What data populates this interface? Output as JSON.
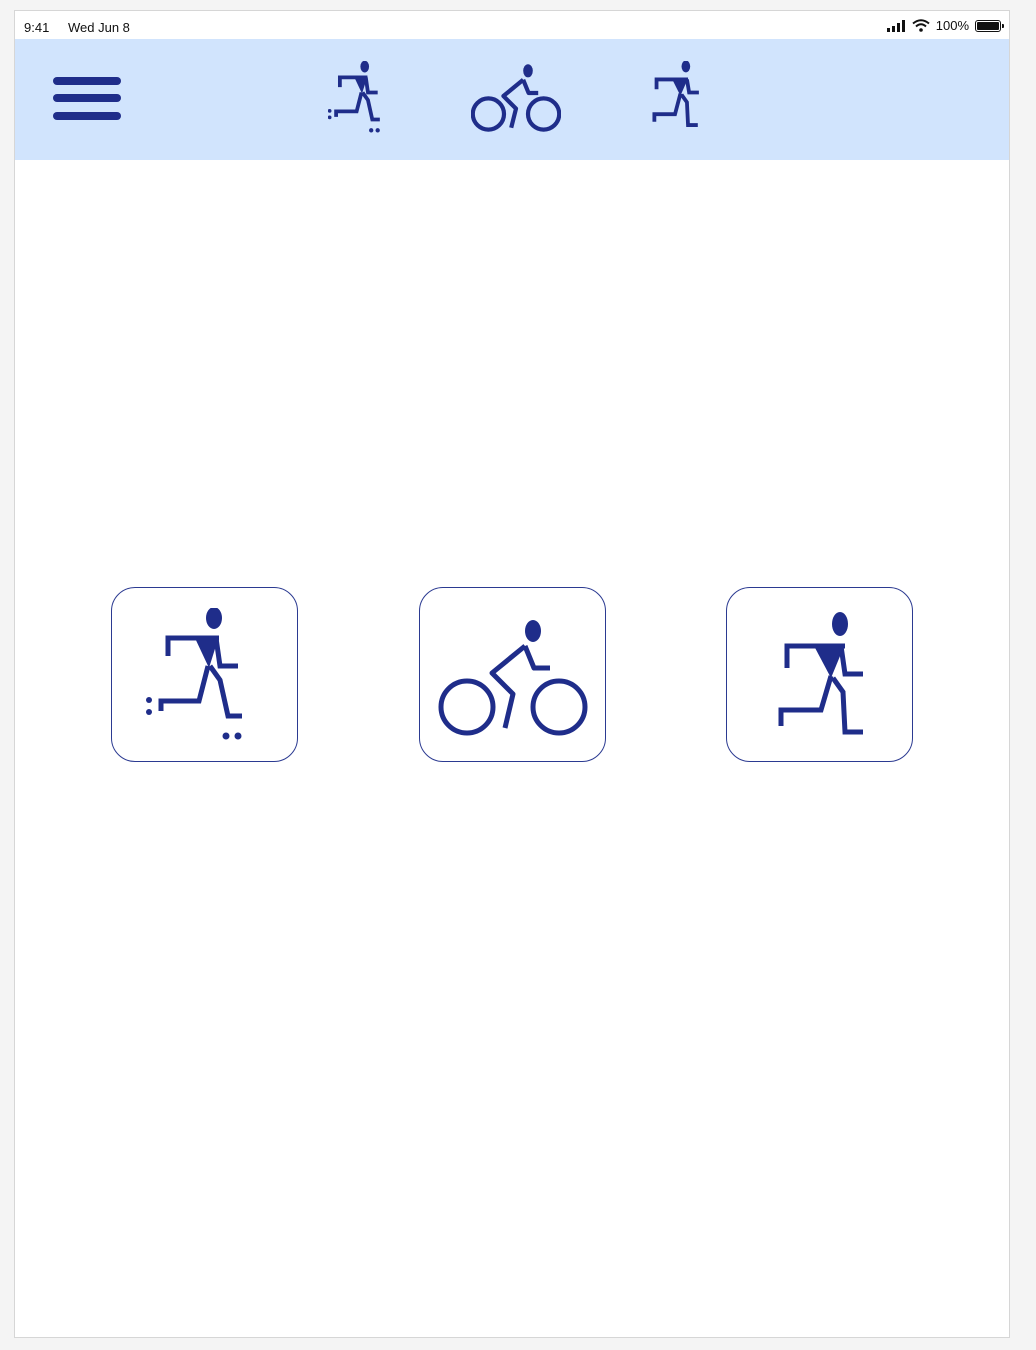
{
  "status_bar": {
    "time": "9:41",
    "date": "Wed Jun 8",
    "battery": "100%",
    "battery_level": 1.0
  },
  "nav_bar": {
    "menu_icon": "hamburger-menu-icon",
    "icons": [
      "inline-skater-icon",
      "cyclist-icon",
      "runner-icon"
    ]
  },
  "activities": [
    {
      "icon": "inline-skater-icon"
    },
    {
      "icon": "cyclist-icon"
    },
    {
      "icon": "runner-icon"
    }
  ],
  "colors": {
    "accent": "#1f2d8a",
    "nav_background": "#d1e4fd",
    "tile_border": "#2b3a91"
  }
}
